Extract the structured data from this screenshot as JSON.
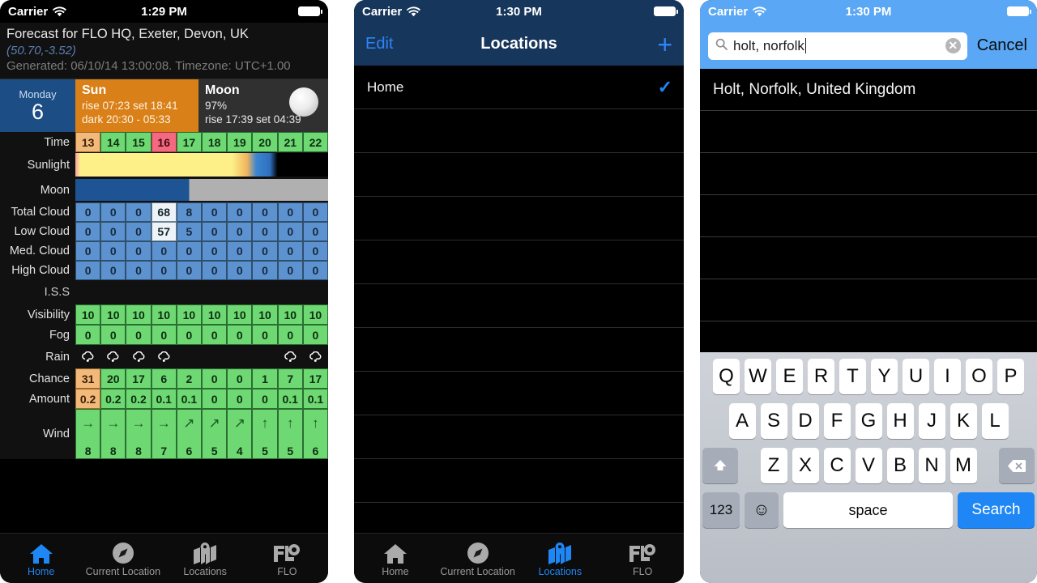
{
  "phone1": {
    "status": {
      "carrier": "Carrier",
      "time": "1:29 PM",
      "wifi_icon": "wifi-icon",
      "battery_icon": "battery-icon"
    },
    "header": {
      "title": "Forecast for FLO HQ, Exeter, Devon, UK",
      "coords": "(50.70,-3.52)",
      "generated": "Generated: 06/10/14 13:00:08. Timezone: UTC+1.00"
    },
    "daystrip": {
      "dayname": "Monday",
      "daynum": "6",
      "sun_title": "Sun",
      "sun_line1": "rise 07:23 set 18:41",
      "sun_line2": "dark 20:30 - 05:33",
      "moon_title": "Moon",
      "moon_line1": "97%",
      "moon_line2": "rise 17:39 set 04:39",
      "moon_icon": "moon-phase-icon"
    },
    "labels": {
      "time": "Time",
      "sunlight": "Sunlight",
      "moon": "Moon",
      "total_cloud": "Total Cloud",
      "low_cloud": "Low Cloud",
      "med_cloud": "Med. Cloud",
      "high_cloud": "High Cloud",
      "iss": "I.S.S",
      "visibility": "Visibility",
      "fog": "Fog",
      "rain": "Rain",
      "chance": "Chance",
      "amount": "Amount",
      "wind": "Wind"
    },
    "tabs": [
      {
        "label": "Home",
        "icon": "home-icon",
        "active": true
      },
      {
        "label": "Current Location",
        "icon": "compass-icon",
        "active": false
      },
      {
        "label": "Locations",
        "icon": "map-pin-icon",
        "active": false
      },
      {
        "label": "FLO",
        "icon": "flo-logo-icon",
        "active": false
      }
    ]
  },
  "phone2": {
    "status": {
      "carrier": "Carrier",
      "time": "1:30 PM"
    },
    "nav": {
      "edit": "Edit",
      "title": "Locations",
      "add": "+"
    },
    "rows": [
      {
        "label": "Home",
        "checked": true
      },
      {
        "label": "",
        "checked": false
      },
      {
        "label": "",
        "checked": false
      },
      {
        "label": "",
        "checked": false
      },
      {
        "label": "",
        "checked": false
      },
      {
        "label": "",
        "checked": false
      },
      {
        "label": "",
        "checked": false
      },
      {
        "label": "",
        "checked": false
      },
      {
        "label": "",
        "checked": false
      },
      {
        "label": "",
        "checked": false
      }
    ],
    "tabs": [
      {
        "label": "Home",
        "icon": "home-icon",
        "active": false
      },
      {
        "label": "Current Location",
        "icon": "compass-icon",
        "active": false
      },
      {
        "label": "Locations",
        "icon": "map-pin-icon",
        "active": true
      },
      {
        "label": "FLO",
        "icon": "flo-logo-icon",
        "active": false
      }
    ]
  },
  "phone3": {
    "status": {
      "carrier": "Carrier",
      "time": "1:30 PM"
    },
    "search": {
      "value": "holt, norfolk",
      "placeholder": "Search",
      "search_icon": "magnifier-icon",
      "clear_icon": "clear-circle-icon",
      "cancel": "Cancel"
    },
    "results": [
      {
        "label": "Holt, Norfolk, United Kingdom"
      },
      {
        "label": ""
      },
      {
        "label": ""
      },
      {
        "label": ""
      },
      {
        "label": ""
      },
      {
        "label": ""
      }
    ],
    "keyboard": {
      "row1": [
        "Q",
        "W",
        "E",
        "R",
        "T",
        "Y",
        "U",
        "I",
        "O",
        "P"
      ],
      "row2": [
        "A",
        "S",
        "D",
        "F",
        "G",
        "H",
        "J",
        "K",
        "L"
      ],
      "row3": [
        "Z",
        "X",
        "C",
        "V",
        "B",
        "N",
        "M"
      ],
      "shift_icon": "shift-up-icon",
      "backspace_icon": "backspace-icon",
      "numbers_label": "123",
      "emoji_icon": "emoji-smiley-icon",
      "space_label": "space",
      "search_label": "Search"
    }
  },
  "chart_data": {
    "type": "table",
    "title": "Forecast for FLO HQ, Exeter, Devon, UK",
    "categories": [
      "13",
      "14",
      "15",
      "16",
      "17",
      "18",
      "19",
      "20",
      "21",
      "22"
    ],
    "time_colors": [
      "o",
      "g",
      "g",
      "r",
      "g",
      "g",
      "g",
      "g",
      "g",
      "g"
    ],
    "rows": [
      {
        "name": "Total Cloud",
        "values": [
          "0",
          "0",
          "0",
          "68",
          "8",
          "0",
          "0",
          "0",
          "0",
          "0"
        ],
        "colors": [
          "b",
          "b",
          "b",
          "w",
          "b",
          "b",
          "b",
          "b",
          "b",
          "b"
        ]
      },
      {
        "name": "Low Cloud",
        "values": [
          "0",
          "0",
          "0",
          "57",
          "5",
          "0",
          "0",
          "0",
          "0",
          "0"
        ],
        "colors": [
          "b",
          "b",
          "b",
          "w",
          "b",
          "b",
          "b",
          "b",
          "b",
          "b"
        ]
      },
      {
        "name": "Med. Cloud",
        "values": [
          "0",
          "0",
          "0",
          "0",
          "0",
          "0",
          "0",
          "0",
          "0",
          "0"
        ],
        "colors": [
          "b",
          "b",
          "b",
          "b",
          "b",
          "b",
          "b",
          "b",
          "b",
          "b"
        ]
      },
      {
        "name": "High Cloud",
        "values": [
          "0",
          "0",
          "0",
          "0",
          "0",
          "0",
          "0",
          "0",
          "0",
          "0"
        ],
        "colors": [
          "b",
          "b",
          "b",
          "b",
          "b",
          "b",
          "b",
          "b",
          "b",
          "b"
        ]
      },
      {
        "name": "Visibility",
        "values": [
          "10",
          "10",
          "10",
          "10",
          "10",
          "10",
          "10",
          "10",
          "10",
          "10"
        ],
        "colors": [
          "g",
          "g",
          "g",
          "g",
          "g",
          "g",
          "g",
          "g",
          "g",
          "g"
        ]
      },
      {
        "name": "Fog",
        "values": [
          "0",
          "0",
          "0",
          "0",
          "0",
          "0",
          "0",
          "0",
          "0",
          "0"
        ],
        "colors": [
          "g",
          "g",
          "g",
          "g",
          "g",
          "g",
          "g",
          "g",
          "g",
          "g"
        ]
      },
      {
        "name": "Chance",
        "values": [
          "31",
          "20",
          "17",
          "6",
          "2",
          "0",
          "0",
          "1",
          "7",
          "17"
        ],
        "colors": [
          "o",
          "g",
          "g",
          "g",
          "g",
          "g",
          "g",
          "g",
          "g",
          "g"
        ]
      },
      {
        "name": "Amount",
        "values": [
          "0.2",
          "0.2",
          "0.2",
          "0.1",
          "0.1",
          "0",
          "0",
          "0",
          "0.1",
          "0.1"
        ],
        "colors": [
          "o",
          "g",
          "g",
          "g",
          "g",
          "g",
          "g",
          "g",
          "g",
          "g"
        ]
      }
    ],
    "rain_icons": [
      true,
      true,
      true,
      true,
      false,
      false,
      false,
      false,
      true,
      true
    ],
    "wind": {
      "arrows": [
        "→",
        "→",
        "→",
        "→",
        "↗",
        "↗",
        "↗",
        "↑",
        "↑",
        "↑"
      ],
      "speeds": [
        "8",
        "8",
        "8",
        "7",
        "6",
        "5",
        "4",
        "5",
        "5",
        "6"
      ]
    },
    "iss_values": [
      "",
      "",
      "",
      "",
      "",
      "",
      "",
      "",
      "",
      ""
    ],
    "sunlight_note": "daylight to 18:41, twilight band, then dark",
    "moon_note": "moon down from ~column 5 onward"
  }
}
